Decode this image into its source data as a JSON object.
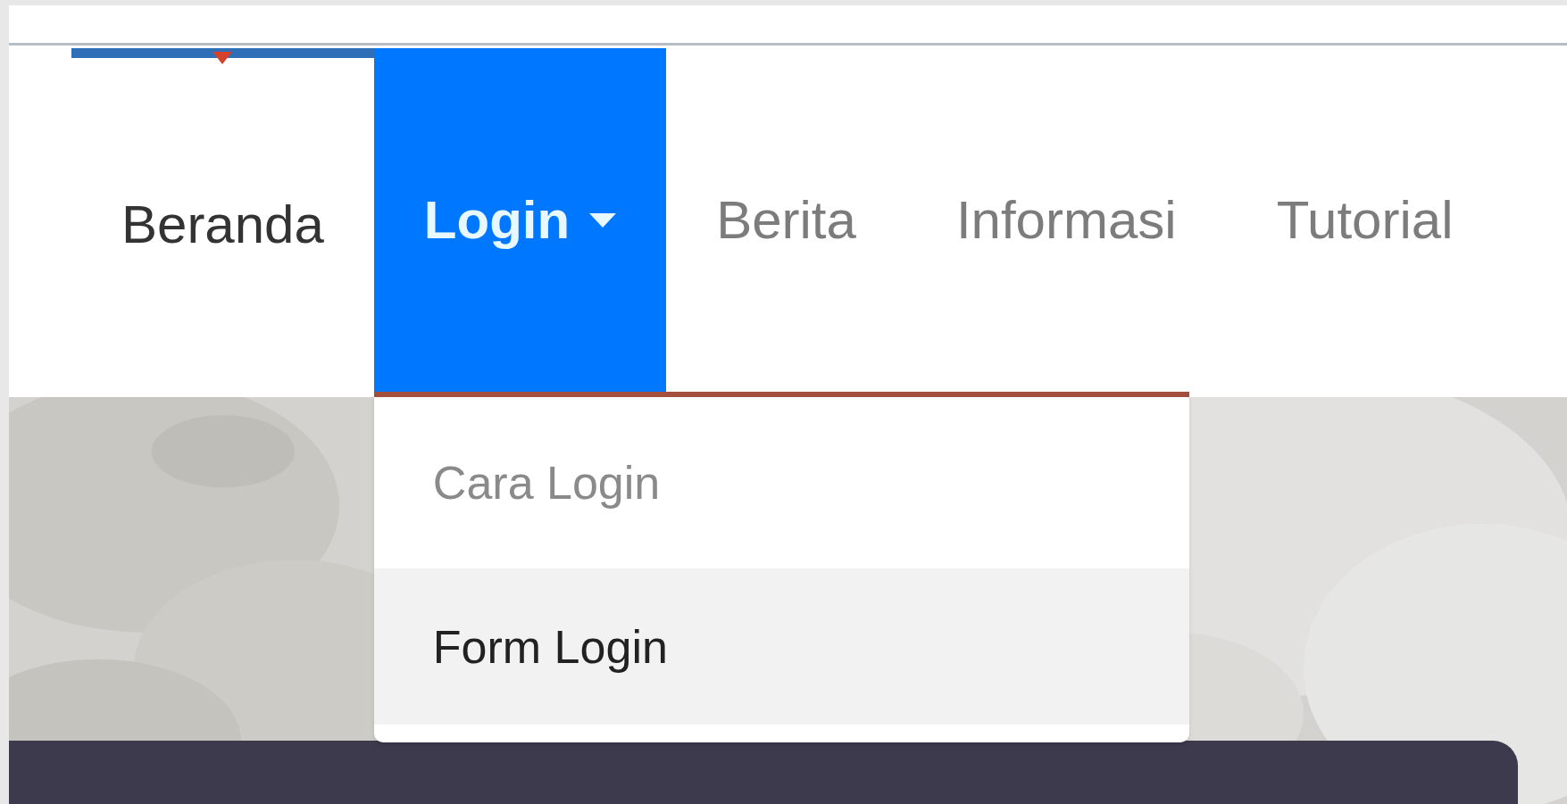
{
  "nav": {
    "items": [
      {
        "label": "Beranda",
        "kind": "link",
        "selected": false,
        "current": true
      },
      {
        "label": "Login",
        "kind": "dropdown",
        "selected": true,
        "current": false
      },
      {
        "label": "Berita",
        "kind": "link",
        "selected": false,
        "current": false
      },
      {
        "label": "Informasi",
        "kind": "link",
        "selected": false,
        "current": false
      },
      {
        "label": "Tutorial",
        "kind": "link",
        "selected": false,
        "current": false
      }
    ]
  },
  "dropdown": {
    "items": [
      {
        "label": "Cara Login",
        "selected": false
      },
      {
        "label": "Form Login",
        "selected": true
      }
    ]
  }
}
